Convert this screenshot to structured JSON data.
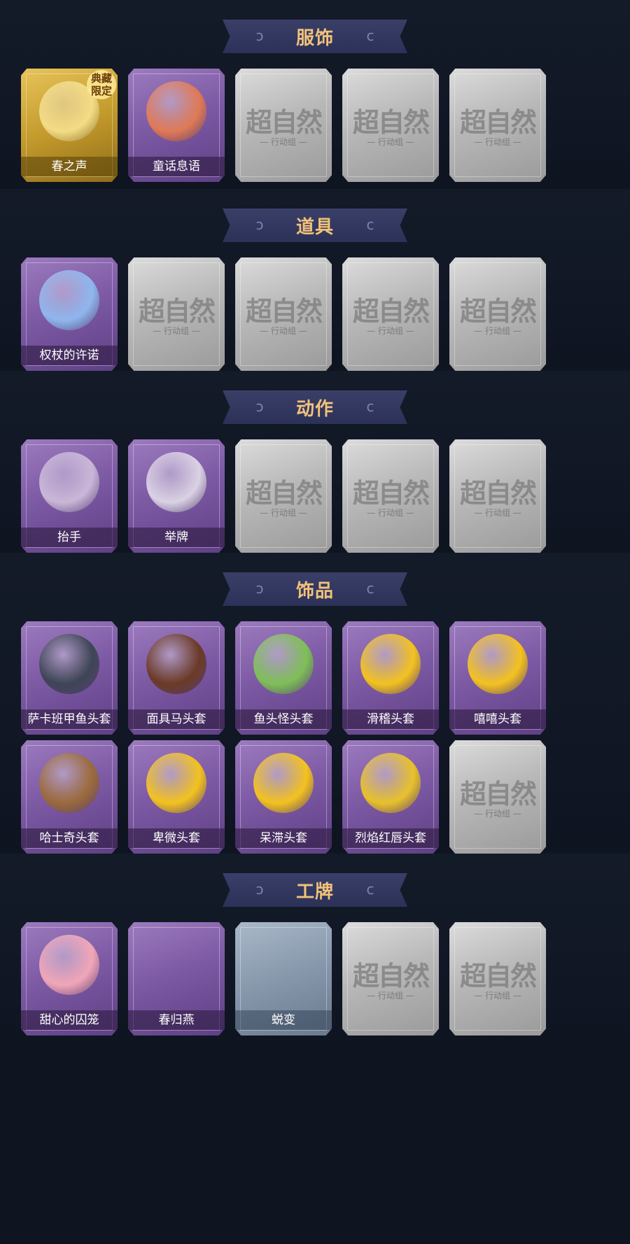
{
  "watermark": {
    "main": "超自然",
    "sub": "— 行动组 —"
  },
  "sections": [
    {
      "title": "服饰",
      "items": [
        {
          "label": "春之声",
          "style": "gold",
          "art": "blonde-woman-portrait",
          "badge": "典藏 限定"
        },
        {
          "label": "童话息语",
          "style": "purple",
          "art": "red-hair-girl-portrait"
        },
        {
          "label": "",
          "style": "gray",
          "art": "placeholder"
        },
        {
          "label": "",
          "style": "gray",
          "art": "placeholder"
        },
        {
          "label": "",
          "style": "gray",
          "art": "placeholder"
        }
      ]
    },
    {
      "title": "道具",
      "items": [
        {
          "label": "权杖的许诺",
          "style": "purple",
          "art": "scepter"
        },
        {
          "label": "",
          "style": "gray",
          "art": "placeholder"
        },
        {
          "label": "",
          "style": "gray",
          "art": "placeholder"
        },
        {
          "label": "",
          "style": "gray",
          "art": "placeholder"
        },
        {
          "label": "",
          "style": "gray",
          "art": "placeholder"
        }
      ]
    },
    {
      "title": "动作",
      "items": [
        {
          "label": "抬手",
          "style": "purple",
          "art": "raise-hand"
        },
        {
          "label": "举牌",
          "style": "purple",
          "art": "hold-sign"
        },
        {
          "label": "",
          "style": "gray",
          "art": "placeholder"
        },
        {
          "label": "",
          "style": "gray",
          "art": "placeholder"
        },
        {
          "label": "",
          "style": "gray",
          "art": "placeholder"
        }
      ]
    },
    {
      "title": "饰品",
      "items": [
        {
          "label": "萨卡班甲鱼头套",
          "style": "purple",
          "art": "fish-head"
        },
        {
          "label": "面具马头套",
          "style": "purple",
          "art": "horse-head"
        },
        {
          "label": "鱼头怪头套",
          "style": "purple",
          "art": "green-fish-head"
        },
        {
          "label": "滑稽头套",
          "style": "purple",
          "art": "smirk-emoji-head"
        },
        {
          "label": "嘻嘻头套",
          "style": "purple",
          "art": "grin-emoji-head"
        },
        {
          "label": "哈士奇头套",
          "style": "purple",
          "art": "dog-head"
        },
        {
          "label": "卑微头套",
          "style": "purple",
          "art": "humble-emoji-head"
        },
        {
          "label": "呆滞头套",
          "style": "purple",
          "art": "dazed-emoji-head"
        },
        {
          "label": "烈焰红唇头套",
          "style": "purple",
          "art": "pikachu-lips-head"
        },
        {
          "label": "",
          "style": "gray",
          "art": "placeholder"
        }
      ]
    },
    {
      "title": "工牌",
      "items": [
        {
          "label": "甜心的囚笼",
          "style": "purple",
          "art": "pink-badge"
        },
        {
          "label": "春归燕",
          "style": "purple",
          "art": "empty"
        },
        {
          "label": "蜕变",
          "style": "blue",
          "art": "empty"
        },
        {
          "label": "",
          "style": "gray",
          "art": "placeholder"
        },
        {
          "label": "",
          "style": "gray",
          "art": "placeholder"
        }
      ]
    }
  ],
  "art_colors": {
    "blonde-woman-portrait": "#f3dc86",
    "red-hair-girl-portrait": "#e07a55",
    "scepter": "#8fb6ee",
    "raise-hand": "#c9b7d8",
    "hold-sign": "#dad2e4",
    "fish-head": "#3e4556",
    "horse-head": "#6b3a26",
    "green-fish-head": "#7fbf57",
    "smirk-emoji-head": "#f3c21f",
    "grin-emoji-head": "#f3c21f",
    "dog-head": "#9b6a3b",
    "humble-emoji-head": "#f3c21f",
    "dazed-emoji-head": "#f3c21f",
    "pikachu-lips-head": "#e8c12b",
    "pink-badge": "#f1a6b8"
  }
}
